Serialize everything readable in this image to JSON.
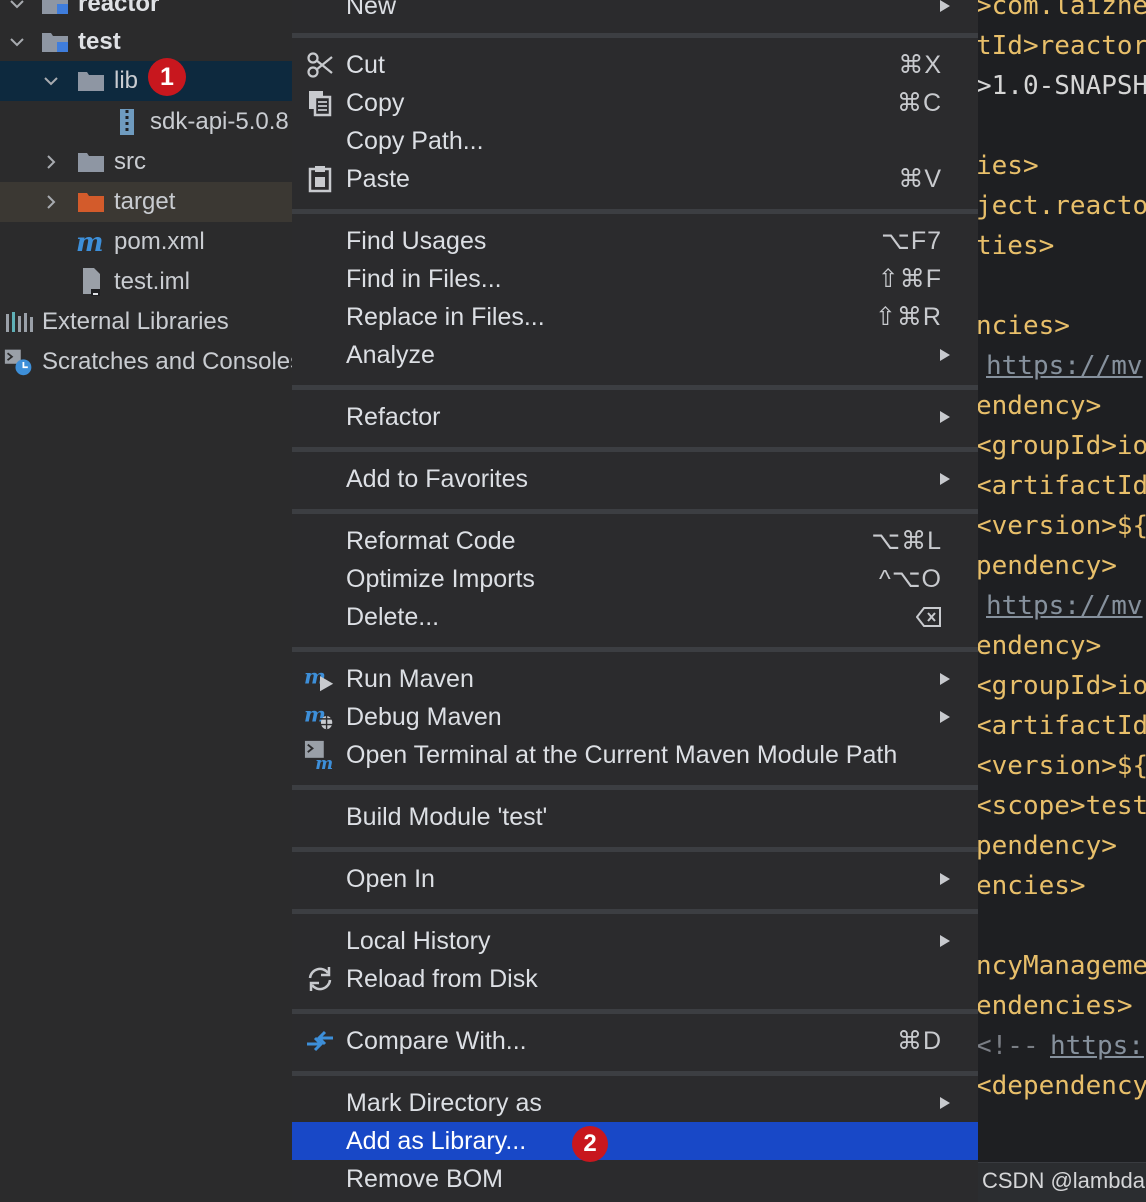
{
  "tree": {
    "items": [
      {
        "label": "reactor"
      },
      {
        "label": "test"
      },
      {
        "label": "lib"
      },
      {
        "label": "sdk-api-5.0.8"
      },
      {
        "label": "src"
      },
      {
        "label": "target"
      },
      {
        "label": "pom.xml"
      },
      {
        "label": "test.iml"
      },
      {
        "label": "External Libraries"
      },
      {
        "label": "Scratches and Consoles"
      }
    ]
  },
  "badges": {
    "first": "1",
    "second": "2"
  },
  "menu": {
    "items": [
      {
        "label": "New",
        "shortcut": ""
      },
      {
        "label": "Cut",
        "shortcut": "⌘X"
      },
      {
        "label": "Copy",
        "shortcut": "⌘C"
      },
      {
        "label": "Copy Path...",
        "shortcut": ""
      },
      {
        "label": "Paste",
        "shortcut": "⌘V"
      },
      {
        "label": "Find Usages",
        "shortcut": "⌥F7"
      },
      {
        "label": "Find in Files...",
        "shortcut": "⇧⌘F"
      },
      {
        "label": "Replace in Files...",
        "shortcut": "⇧⌘R"
      },
      {
        "label": "Analyze",
        "shortcut": ""
      },
      {
        "label": "Refactor",
        "shortcut": ""
      },
      {
        "label": "Add to Favorites",
        "shortcut": ""
      },
      {
        "label": "Reformat Code",
        "shortcut": "⌥⌘L"
      },
      {
        "label": "Optimize Imports",
        "shortcut": "^⌥O"
      },
      {
        "label": "Delete...",
        "shortcut": ""
      },
      {
        "label": "Run Maven",
        "shortcut": ""
      },
      {
        "label": "Debug Maven",
        "shortcut": ""
      },
      {
        "label": "Open Terminal at the Current Maven Module Path",
        "shortcut": ""
      },
      {
        "label": "Build Module 'test'",
        "shortcut": ""
      },
      {
        "label": "Open In",
        "shortcut": ""
      },
      {
        "label": "Local History",
        "shortcut": ""
      },
      {
        "label": "Reload from Disk",
        "shortcut": ""
      },
      {
        "label": "Compare With...",
        "shortcut": "⌘D"
      },
      {
        "label": "Mark Directory as",
        "shortcut": ""
      },
      {
        "label": "Add as Library...",
        "shortcut": ""
      },
      {
        "label": "Remove BOM",
        "shortcut": ""
      }
    ]
  },
  "editor": {
    "lines": [
      ">com.laizhe",
      "tId>reactor",
      ">1.0-SNAPSH",
      "ies>",
      "ject.reacto",
      "ties>",
      "ncies>",
      "https://mv",
      "endency>",
      "<groupId>io",
      "<artifactId",
      "<version>${",
      "pendency>",
      "https://mv",
      "endency>",
      "<groupId>io",
      "<artifactId",
      "<version>${",
      "<scope>test",
      "pendency>",
      "encies>",
      "ncyManageme",
      "endencies>",
      "<!-- ",
      "https:",
      "<dependency"
    ]
  },
  "watermark": "CSDN @lambda."
}
